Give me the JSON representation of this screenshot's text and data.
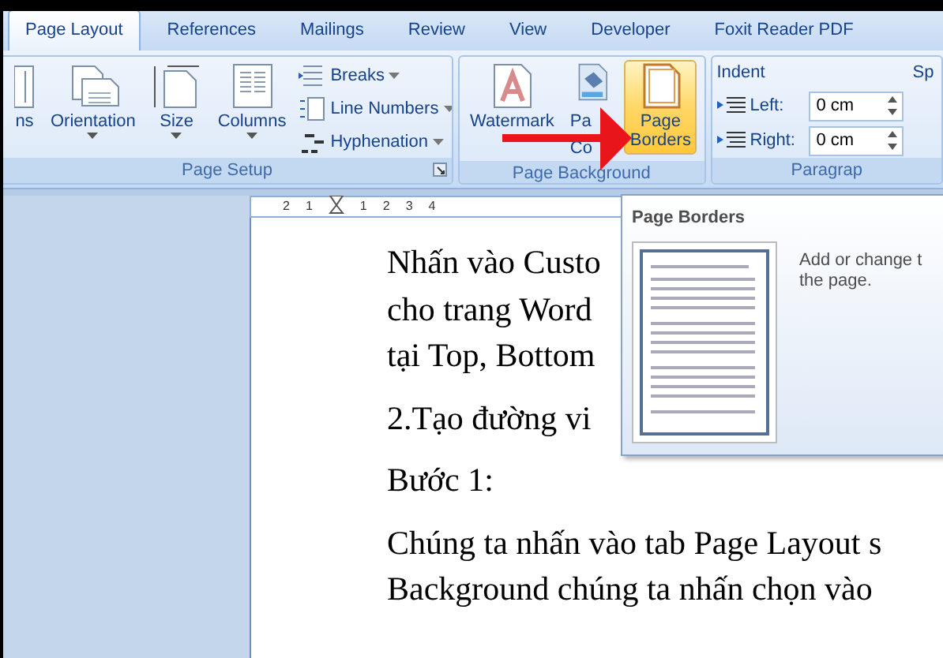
{
  "tabs": [
    {
      "label": "Page Layout",
      "selected": true
    },
    {
      "label": "References",
      "selected": false
    },
    {
      "label": "Mailings",
      "selected": false
    },
    {
      "label": "Review",
      "selected": false
    },
    {
      "label": "View",
      "selected": false
    },
    {
      "label": "Developer",
      "selected": false
    },
    {
      "label": "Foxit Reader PDF",
      "selected": false
    }
  ],
  "groups": [
    {
      "label": "Page Setup",
      "launcher": true,
      "items": [
        {
          "kind": "large",
          "lines": [
            "ns"
          ],
          "dropdown": false,
          "selected": false
        },
        {
          "kind": "large",
          "lines": [
            "Orientation"
          ],
          "dropdown": true,
          "selected": false
        },
        {
          "kind": "large",
          "lines": [
            "Size"
          ],
          "dropdown": true,
          "selected": false
        },
        {
          "kind": "large",
          "lines": [
            "Columns"
          ],
          "dropdown": true,
          "selected": false
        },
        {
          "kind": "stack",
          "entries": [
            {
              "label": "Breaks"
            },
            {
              "label": "Line Numbers"
            },
            {
              "label": "Hyphenation"
            }
          ]
        }
      ]
    },
    {
      "label": "Page Background",
      "launcher": false,
      "items": [
        {
          "kind": "large",
          "lines": [
            "Watermark"
          ],
          "dropdown": false,
          "selected": false
        },
        {
          "kind": "large",
          "lines": [
            "Pa",
            "Co"
          ],
          "dropdown": false,
          "selected": false
        },
        {
          "kind": "large",
          "lines": [
            "Page",
            "Borders"
          ],
          "dropdown": false,
          "selected": true
        }
      ]
    },
    {
      "label": "Paragrap",
      "launcher": false,
      "items": [
        {
          "kind": "indent",
          "title": "Indent",
          "fields": [
            {
              "label": "Left:",
              "value": "0 cm"
            },
            {
              "label": "Right:",
              "value": "0 cm"
            }
          ]
        },
        {
          "kind": "cut",
          "title": "Sp"
        }
      ]
    }
  ],
  "ruler": {
    "labels": [
      "2",
      "1",
      "1",
      "2",
      "3",
      "4"
    ]
  },
  "document": {
    "paragraphs": [
      {
        "lines": [
          "Nhấn vào Custo",
          "cho trang Word",
          "tại Top, Bottom"
        ]
      },
      {
        "lines": [
          "2.Tạo đường vi"
        ]
      },
      {
        "lines": [
          "Bước 1:"
        ]
      },
      {
        "lines": [
          "Chúng ta nhấn vào tab Page Layout s",
          "Background chúng ta nhấn chọn vào"
        ]
      }
    ]
  },
  "tooltip": {
    "title": "Page Borders",
    "description": [
      "Add or change t",
      "the page."
    ]
  }
}
